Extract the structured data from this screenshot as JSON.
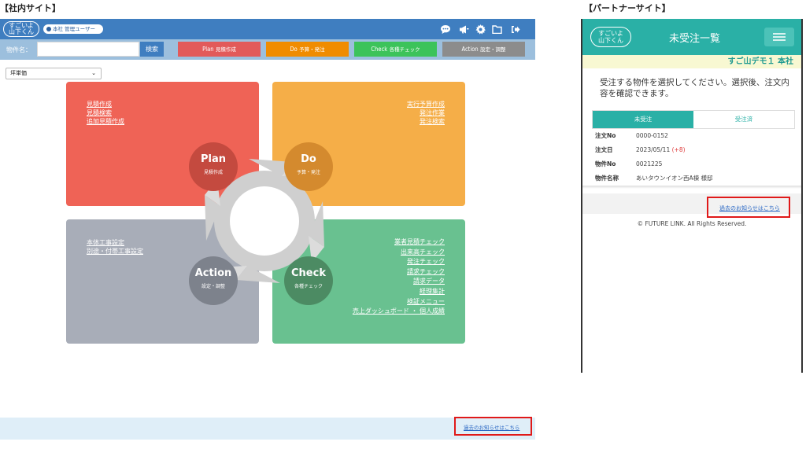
{
  "captions": {
    "internal": "【社内サイト】",
    "partner": "【パートナーサイト】"
  },
  "internal": {
    "logo_line1": "すごいよ",
    "logo_line2": "山下くん",
    "user": {
      "branch": "本社",
      "role": "管理ユーザー"
    },
    "header_icons": [
      "chat-icon",
      "megaphone-icon",
      "gear-icon",
      "folder-icon",
      "logout-icon"
    ],
    "search": {
      "label": "物件名：",
      "value": "",
      "button": "検索"
    },
    "phase_buttons": [
      {
        "en": "Plan",
        "jp": "見積作成",
        "color": "#e25a5a"
      },
      {
        "en": "Do",
        "jp": "予算・発注",
        "color": "#f08c00"
      },
      {
        "en": "Check",
        "jp": "各種チェック",
        "color": "#3cc35a"
      },
      {
        "en": "Action",
        "jp": "設定・調整",
        "color": "#8c8c8c"
      }
    ],
    "unit_select": {
      "selected": "坪単価"
    },
    "plan": {
      "title": "Plan",
      "subtitle": "見積作成",
      "links": [
        "見積作成",
        "見積検索",
        "追加見積作成"
      ]
    },
    "do": {
      "title": "Do",
      "subtitle": "予算・発注",
      "links": [
        "実行予算作成",
        "発注作業",
        "発注検索"
      ]
    },
    "action": {
      "title": "Action",
      "subtitle": "設定・調整",
      "links": [
        "本体工事設定",
        "別途・付帯工事設定"
      ]
    },
    "check": {
      "title": "Check",
      "subtitle": "各種チェック",
      "links": [
        "業者見積チェック",
        "出来高チェック",
        "発注チェック",
        "請求チェック",
        "請求データ",
        "経理集計",
        "検証メニュー",
        "売上ダッシュボード ・ 個人成績"
      ]
    },
    "past_notice": "過去のお知らせはこちら"
  },
  "partner": {
    "logo_line1": "すごいよ",
    "logo_line2": "山下くん",
    "title": "未受注一覧",
    "company": "すご山デモ１ 本社",
    "instruction": "受注する物件を選択してください。選択後、注文内容を確認できます。",
    "tabs": [
      "未受注",
      "受注済"
    ],
    "order": {
      "no_label": "注文No",
      "no": "0000-0152",
      "date_label": "注文日",
      "date": "2023/05/11",
      "date_extra": "(+8)",
      "prop_no_label": "物件No",
      "prop_no": "0021225",
      "prop_name_label": "物件名称",
      "prop_name": "あいタウンイオン西A棟 様邸"
    },
    "past_notice": "過去のお知らせはこちら",
    "copyright": "© FUTURE LINK. All Rights Reserved."
  }
}
